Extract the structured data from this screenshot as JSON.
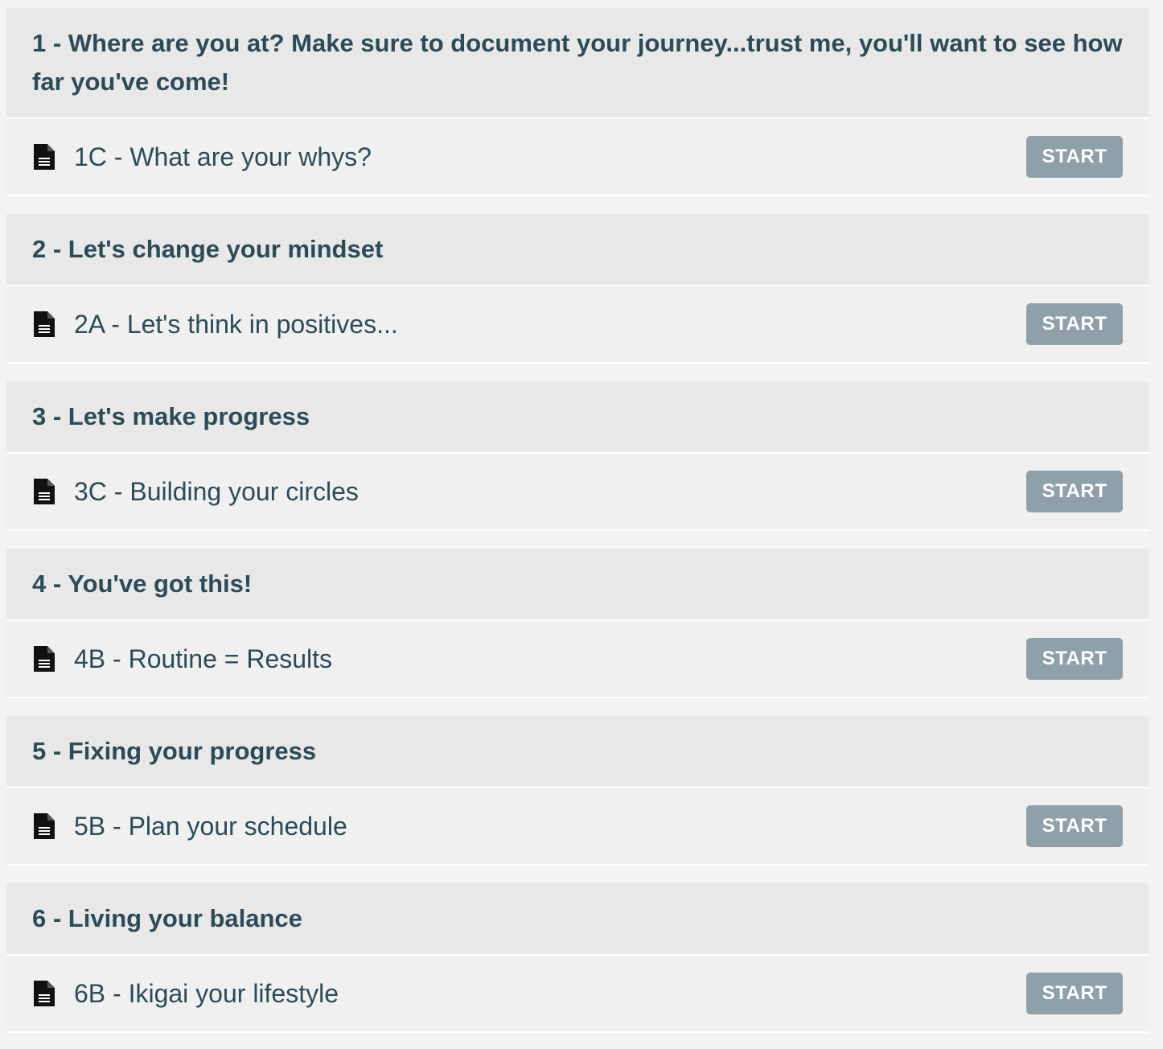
{
  "sections": [
    {
      "title": "1 - Where are you at? Make sure to document your journey...trust me, you'll want to see how far you've come!",
      "lesson": {
        "icon": "document-icon",
        "title": "1C - What are your whys?",
        "button": "START"
      }
    },
    {
      "title": "2 - Let's change your mindset",
      "lesson": {
        "icon": "document-icon",
        "title": "2A - Let's think in positives...",
        "button": "START"
      }
    },
    {
      "title": "3 - Let's make progress",
      "lesson": {
        "icon": "document-icon",
        "title": "3C - Building your circles",
        "button": "START"
      }
    },
    {
      "title": "4 - You've got this!",
      "lesson": {
        "icon": "document-icon",
        "title": "4B - Routine = Results",
        "button": "START"
      }
    },
    {
      "title": "5 - Fixing your progress",
      "lesson": {
        "icon": "document-icon",
        "title": "5B - Plan your schedule",
        "button": "START"
      }
    },
    {
      "title": "6 - Living your balance",
      "lesson": {
        "icon": "document-icon",
        "title": "6B - Ikigai your lifestyle",
        "button": "START"
      }
    }
  ],
  "colors": {
    "text": "#2b4b59",
    "header_bg": "#e8e8e8",
    "row_bg": "#f0f0f0",
    "button_bg": "#8fa0a8",
    "button_text": "#ffffff"
  }
}
